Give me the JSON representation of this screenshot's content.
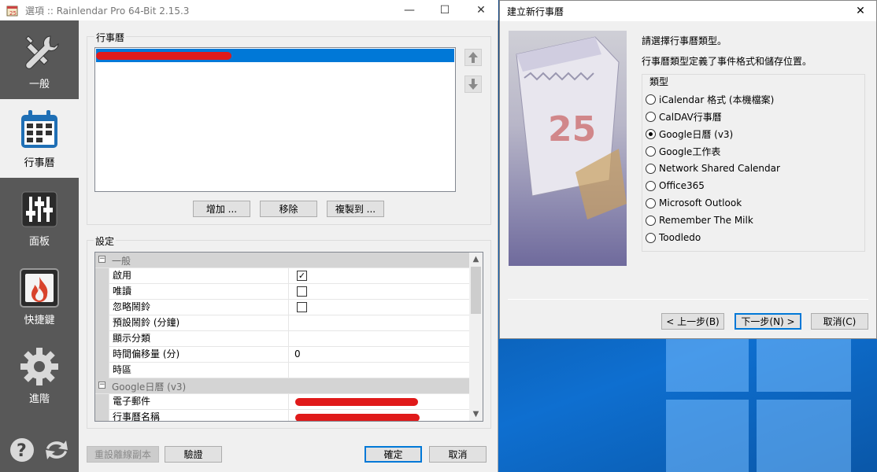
{
  "main_window": {
    "title": "選項 :: Rainlendar Pro 64-Bit 2.15.3",
    "minimize": "—",
    "maximize": "☐",
    "close": "✕"
  },
  "sidebar": {
    "items": [
      {
        "label": "一般",
        "icon": "wrench-icon"
      },
      {
        "label": "行事曆",
        "icon": "calendar-icon"
      },
      {
        "label": "面板",
        "icon": "sliders-icon"
      },
      {
        "label": "快捷鍵",
        "icon": "flame-icon"
      },
      {
        "label": "進階",
        "icon": "gear-icon"
      }
    ],
    "bottom_icons": [
      "help-icon",
      "sync-icon"
    ]
  },
  "calendars_section": {
    "label": "行事曆",
    "buttons": {
      "add": "增加 ...",
      "remove": "移除",
      "copy_to": "複製到 ..."
    }
  },
  "settings_section": {
    "label": "設定",
    "categories": [
      {
        "name": "一般",
        "toggle": "⊟"
      },
      {
        "name": "Google日曆 (v3)",
        "toggle": "⊟"
      }
    ],
    "rows": [
      {
        "name": "啟用",
        "value": "",
        "checked": true
      },
      {
        "name": "唯讀",
        "value": "",
        "checked": false
      },
      {
        "name": "忽略鬧鈴",
        "value": "",
        "checked": false
      },
      {
        "name": "預設鬧鈴 (分鐘)",
        "value": ""
      },
      {
        "name": "顯示分類",
        "value": ""
      },
      {
        "name": "時間偏移量 (分)",
        "value": "0"
      },
      {
        "name": "時區",
        "value": ""
      },
      {
        "name": "電子郵件",
        "value": ""
      },
      {
        "name": "行事曆名稱",
        "value": ""
      }
    ]
  },
  "footer_buttons": {
    "reset": "重設離線副本",
    "verify": "驗證",
    "ok": "確定",
    "cancel": "取消"
  },
  "wizard": {
    "title": "建立新行事曆",
    "close": "✕",
    "prompt": "請選擇行事曆類型。",
    "description": "行事曆類型定義了事件格式和儲存位置。",
    "group_label": "類型",
    "art_number": "25",
    "types": [
      {
        "label": "iCalendar 格式 (本機檔案)",
        "selected": false
      },
      {
        "label": "CalDAV行事曆",
        "selected": false
      },
      {
        "label": "Google日曆 (v3)",
        "selected": true
      },
      {
        "label": "Google工作表",
        "selected": false
      },
      {
        "label": "Network Shared Calendar",
        "selected": false
      },
      {
        "label": "Office365",
        "selected": false
      },
      {
        "label": "Microsoft Outlook",
        "selected": false
      },
      {
        "label": "Remember The Milk",
        "selected": false
      },
      {
        "label": "Toodledo",
        "selected": false
      }
    ],
    "buttons": {
      "back": "< 上一步(B)",
      "next": "下一步(N) >",
      "cancel": "取消(C)"
    }
  },
  "colors": {
    "accent": "#0078d7",
    "sidebar": "#585858",
    "redaction": "#e01a1a"
  }
}
